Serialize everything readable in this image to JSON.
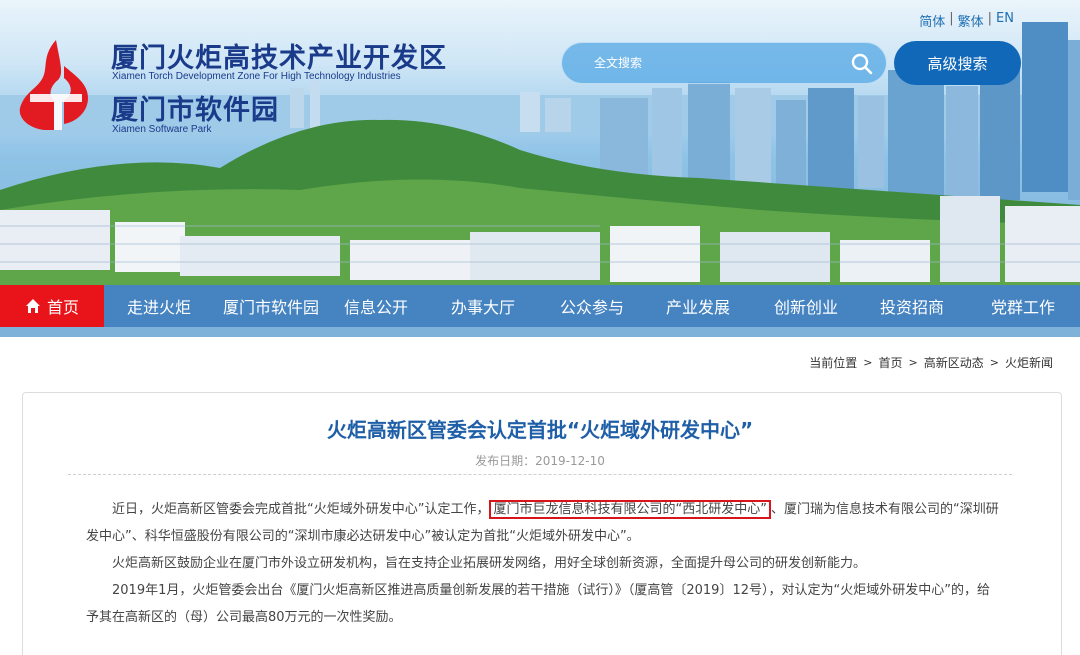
{
  "header": {
    "lang": [
      "简体",
      "繁体",
      "EN"
    ],
    "title_cn": "厦门火炬高技术产业开发区",
    "title_en": "Xiamen Torch Development Zone For High Technology Industries",
    "title2_cn": "厦门市软件园",
    "title2_en": "Xiamen Software Park",
    "search_placeholder": "全文搜索",
    "advanced_search": "高级搜索",
    "colors": {
      "brand_blue": "#1a3a8a",
      "accent_red": "#e8141a",
      "nav_blue": "#1160af"
    }
  },
  "nav": {
    "items": [
      "首页",
      "走进火炬",
      "厦门市软件园",
      "信息公开",
      "办事大厅",
      "公众参与",
      "产业发展",
      "创新创业",
      "投资招商",
      "党群工作"
    ],
    "active_index": 0
  },
  "breadcrumb": {
    "label": "当前位置",
    "items": [
      "首页",
      "高新区动态",
      "火炬新闻"
    ]
  },
  "article": {
    "title": "火炬高新区管委会认定首批“火炬域外研发中心”",
    "date": "发布日期：2019-12-10",
    "p1_a": "近日，火炬高新区管委会完成首批“火炬域外研发中心”认定工作，",
    "p1_highlight": "厦门市巨龙信息科技有限公司的“西北研发中心”",
    "p1_b": "、厦门瑞为信息技术有限公司的“深圳研发中心”、科华恒盛股份有限公司的“深圳市康必达研发中心”被认定为首批“火炬域外研发中心”。",
    "p2": "火炬高新区鼓励企业在厦门市外设立研发机构，旨在支持企业拓展研发网络，用好全球创新资源，全面提升母公司的研发创新能力。",
    "p3": "2019年1月，火炬管委会出台《厦门火炬高新区推进高质量创新发展的若干措施（试行）》（厦高管〔2019〕12号），对认定为“火炬域外研发中心”的，给予其在高新区的（母）公司最高80万元的一次性奖励。"
  }
}
